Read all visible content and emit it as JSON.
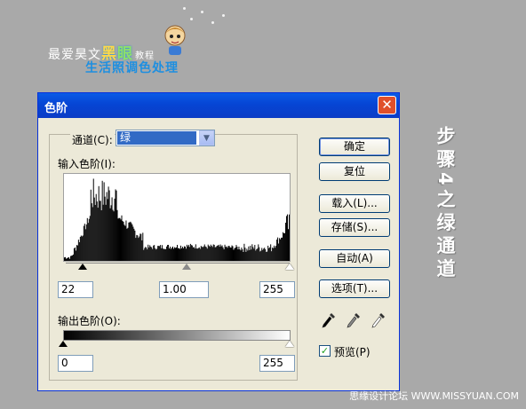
{
  "banner": {
    "line1_prefix": "最爱昊文",
    "accent_a": "黑",
    "accent_b": "眼",
    "small": "教程",
    "line2": "生活照调色处理"
  },
  "step_text": "步骤4之绿通道",
  "watermark": "思缘设计论坛 WWW.MISSYUAN.COM",
  "dialog": {
    "title": "色阶",
    "close_glyph": "✕",
    "channel_label": "通道(C):",
    "channel_value": "绿",
    "input_levels_label": "输入色阶(I):",
    "input_values": [
      "22",
      "1.00",
      "255"
    ],
    "output_levels_label": "输出色阶(O):",
    "output_values": [
      "0",
      "255"
    ],
    "buttons": {
      "ok": "确定",
      "reset": "复位",
      "load": "载入(L)...",
      "save": "存储(S)...",
      "auto": "自动(A)",
      "options": "选项(T)..."
    },
    "preview_label": "预览(P)",
    "preview_checked": true,
    "eyedroppers": [
      "black-eyedropper-icon",
      "gray-eyedropper-icon",
      "white-eyedropper-icon"
    ]
  },
  "colors": {
    "titlebar": "#0a5ae6",
    "selection": "#316ac5",
    "accent": "#1e8fe0"
  }
}
